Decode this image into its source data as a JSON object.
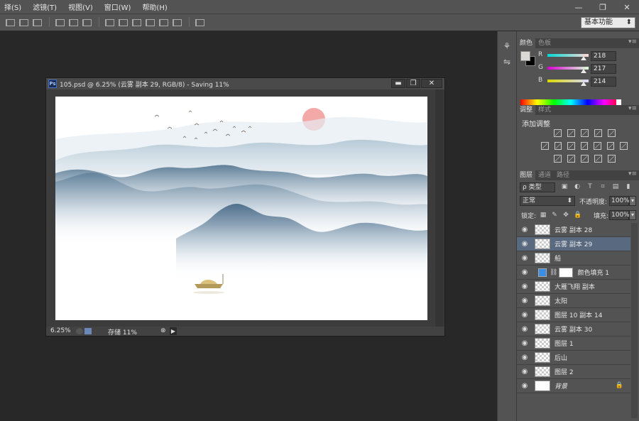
{
  "menubar": {
    "items": [
      "择(S)",
      "滤镜(T)",
      "视图(V)",
      "窗口(W)",
      "帮助(H)"
    ],
    "controls": [
      "—",
      "❐",
      "✕"
    ]
  },
  "options": {
    "workspace": "基本功能"
  },
  "color_panel": {
    "tabs": [
      "颜色",
      "色板"
    ],
    "r_label": "R",
    "g_label": "G",
    "b_label": "B",
    "r": "218",
    "g": "217",
    "b": "214",
    "foreground": "#dad9d6",
    "background": "#000000"
  },
  "adjust_panel": {
    "tabs": [
      "调整",
      "样式"
    ],
    "title": "添加调整"
  },
  "layers_panel": {
    "tabs": [
      "图层",
      "通道",
      "路径"
    ],
    "kind": "ρ 类型",
    "blend_mode": "正常",
    "opacity_label": "不透明度:",
    "opacity": "100%",
    "lock_label": "锁定:",
    "fill_label": "填充:",
    "fill": "100%",
    "layers": [
      {
        "name": "云雾 副本 28",
        "selected": false
      },
      {
        "name": "云雾 副本 29",
        "selected": true
      },
      {
        "name": "船",
        "selected": false
      },
      {
        "name": "颜色填充 1",
        "selected": false,
        "fill": "#3a8ee6"
      },
      {
        "name": "大雁飞翔 副本",
        "selected": false
      },
      {
        "name": "太阳",
        "selected": false
      },
      {
        "name": "图层 10 副本 14",
        "selected": false
      },
      {
        "name": "云雾 副本 30",
        "selected": false
      },
      {
        "name": "图层 1",
        "selected": false
      },
      {
        "name": "后山",
        "selected": false
      },
      {
        "name": "图层 2",
        "selected": false
      },
      {
        "name": "背景",
        "selected": false,
        "locked": true
      }
    ]
  },
  "document": {
    "title": "105.psd @ 6.25% (云雾 副本 29, RGB/8) - Saving 11%",
    "zoom": "6.25%",
    "status": "存储 11%",
    "controls": [
      "▬",
      "❐",
      "✕"
    ]
  }
}
